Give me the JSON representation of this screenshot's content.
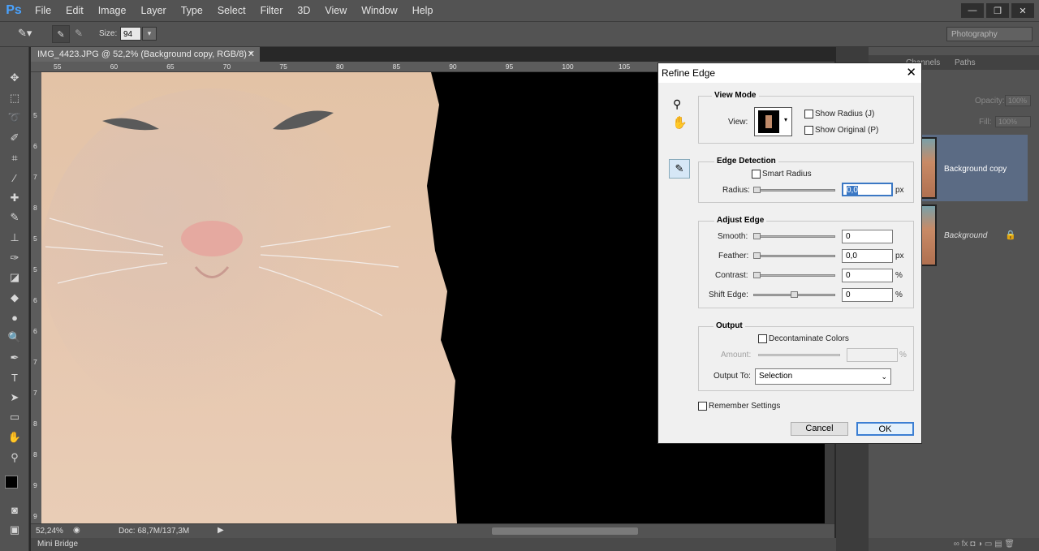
{
  "app": {
    "logo": "Ps"
  },
  "menu": [
    "File",
    "Edit",
    "Image",
    "Layer",
    "Type",
    "Select",
    "Filter",
    "3D",
    "View",
    "Window",
    "Help"
  ],
  "window_controls": [
    "—",
    "❐",
    "✕"
  ],
  "options": {
    "size_label": "Size:",
    "size_value": "94",
    "workspace": "Photography"
  },
  "document": {
    "tab_title": "IMG_4423.JPG @ 52,2% (Background copy, RGB/8) *",
    "ruler_top": [
      "55",
      "60",
      "65",
      "70",
      "75",
      "80",
      "85",
      "90",
      "95",
      "100",
      "105"
    ],
    "ruler_left": [
      "5",
      "6",
      "7",
      "8",
      "5",
      "5",
      "6",
      "6",
      "7",
      "7",
      "8",
      "8",
      "9",
      "9"
    ],
    "zoom": "52,24%",
    "doc_size": "Doc: 68,7M/137,3M"
  },
  "mini_bridge": "Mini Bridge",
  "panels": {
    "tabs": [
      "Channels",
      "Paths"
    ],
    "opacity_label": "Opacity:",
    "opacity_value": "100%",
    "fill_label": "Fill:",
    "fill_value": "100%",
    "layers": [
      {
        "name": "Background copy",
        "selected": true
      },
      {
        "name": "Background",
        "selected": false,
        "locked": true
      }
    ]
  },
  "dialog": {
    "title": "Refine Edge",
    "view_mode": {
      "title": "View Mode",
      "view_label": "View:",
      "show_radius": "Show Radius (J)",
      "show_original": "Show Original (P)"
    },
    "edge_detection": {
      "title": "Edge Detection",
      "smart_radius": "Smart Radius",
      "radius_label": "Radius:",
      "radius_value": "0,0",
      "radius_unit": "px"
    },
    "adjust_edge": {
      "title": "Adjust Edge",
      "smooth_label": "Smooth:",
      "smooth_value": "0",
      "feather_label": "Feather:",
      "feather_value": "0,0",
      "feather_unit": "px",
      "contrast_label": "Contrast:",
      "contrast_value": "0",
      "contrast_unit": "%",
      "shift_label": "Shift Edge:",
      "shift_value": "0",
      "shift_unit": "%"
    },
    "output": {
      "title": "Output",
      "decontaminate": "Decontaminate Colors",
      "amount_label": "Amount:",
      "amount_unit": "%",
      "output_to_label": "Output To:",
      "output_to_value": "Selection"
    },
    "remember": "Remember Settings",
    "cancel": "Cancel",
    "ok": "OK"
  }
}
